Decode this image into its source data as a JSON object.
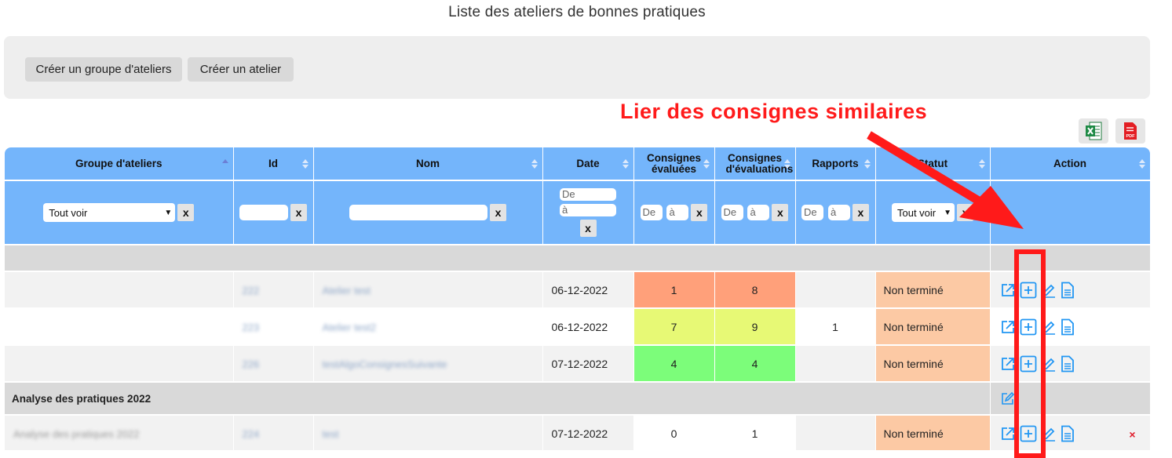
{
  "page": {
    "title": "Liste des ateliers de bonnes pratiques"
  },
  "toolbar": {
    "create_group_label": "Créer un groupe d'ateliers",
    "create_atelier_label": "Créer un atelier"
  },
  "annotation": {
    "text": "Lier des consignes similaires",
    "color": "#ff1a1a"
  },
  "exports": {
    "excel_icon": "excel-icon",
    "pdf_icon": "pdf-icon",
    "pdf_text": "PDF"
  },
  "table": {
    "columns": [
      {
        "key": "groupe",
        "label": "Groupe d'ateliers"
      },
      {
        "key": "id",
        "label": "Id"
      },
      {
        "key": "nom",
        "label": "Nom"
      },
      {
        "key": "date",
        "label": "Date"
      },
      {
        "key": "consignes_evaluees",
        "label": "Consignes évaluées"
      },
      {
        "key": "consignes_evaluations",
        "label": "Consignes d'évaluations"
      },
      {
        "key": "rapports",
        "label": "Rapports"
      },
      {
        "key": "statut",
        "label": "Statut"
      },
      {
        "key": "action",
        "label": "Action"
      }
    ],
    "filters": {
      "groupe_select": "Tout voir",
      "clear": "x",
      "date_from_placeholder": "De",
      "date_to_placeholder": "à",
      "range_from": "De",
      "range_to": "à",
      "statut_select": "Tout voir"
    },
    "rows": [
      {
        "groupe": "",
        "id": "222",
        "nom": "Atelier test",
        "date": "06-12-2022",
        "consignes_evaluees": "1",
        "consignes_evaluations": "8",
        "rapports": "",
        "statut": "Non terminé"
      },
      {
        "groupe": "",
        "id": "223",
        "nom": "Atelier test2",
        "date": "06-12-2022",
        "consignes_evaluees": "7",
        "consignes_evaluations": "9",
        "rapports": "1",
        "statut": "Non terminé"
      },
      {
        "groupe": "",
        "id": "226",
        "nom": "testAlgoConsignesSuivante",
        "date": "07-12-2022",
        "consignes_evaluees": "4",
        "consignes_evaluations": "4",
        "rapports": "",
        "statut": "Non terminé"
      }
    ],
    "group_row": {
      "label": "Analyse des pratiques 2022"
    },
    "group_rows": [
      {
        "groupe": "Analyse des pratiques 2022",
        "id": "224",
        "nom": "test",
        "date": "07-12-2022",
        "consignes_evaluees": "0",
        "consignes_evaluations": "1",
        "rapports": "",
        "statut": "Non terminé",
        "delete": "×"
      }
    ]
  },
  "colors": {
    "header_blue": "#74b5fb",
    "status_peach": "#fcc9a4",
    "orange": "#ffa07a",
    "yellow": "#e7f975",
    "green": "#7cfd7a",
    "icon_blue": "#2196f3",
    "highlight_red": "#ff1a1a"
  }
}
